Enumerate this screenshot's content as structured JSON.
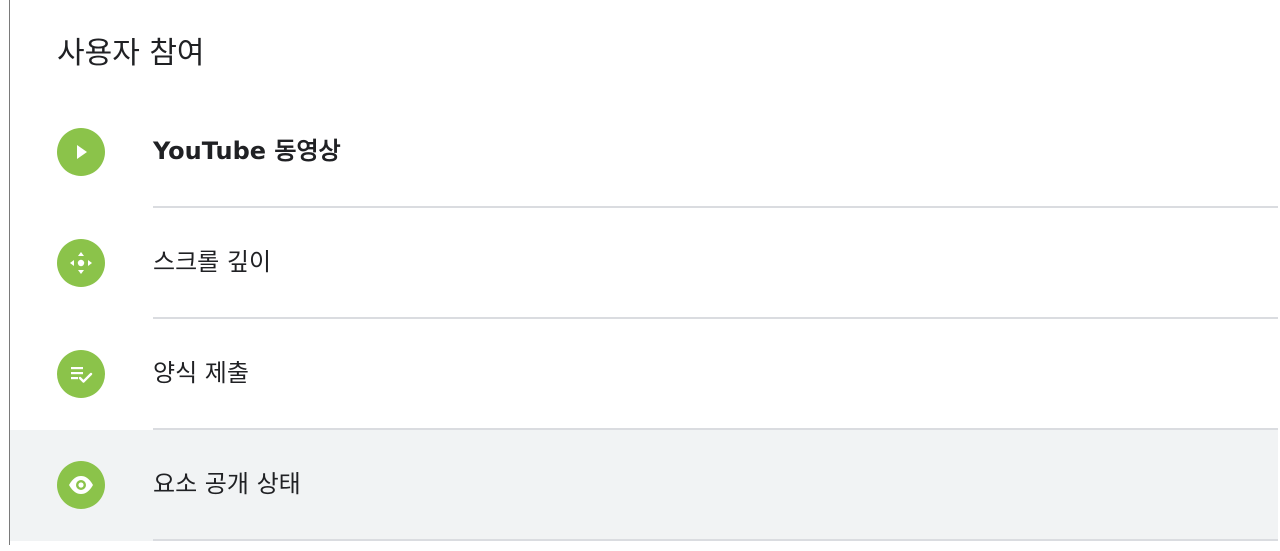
{
  "section": {
    "title": "사용자 참여"
  },
  "items": [
    {
      "label": "YouTube 동영상",
      "icon": "play-icon"
    },
    {
      "label": "스크롤 깊이",
      "icon": "move-arrows-icon"
    },
    {
      "label": "양식 제출",
      "icon": "form-check-icon"
    },
    {
      "label": "요소 공개 상태",
      "icon": "eye-icon"
    }
  ],
  "colors": {
    "icon_background": "#8bc34a",
    "hover_background": "#f1f3f4",
    "divider": "#dadce0",
    "text": "#202124"
  }
}
